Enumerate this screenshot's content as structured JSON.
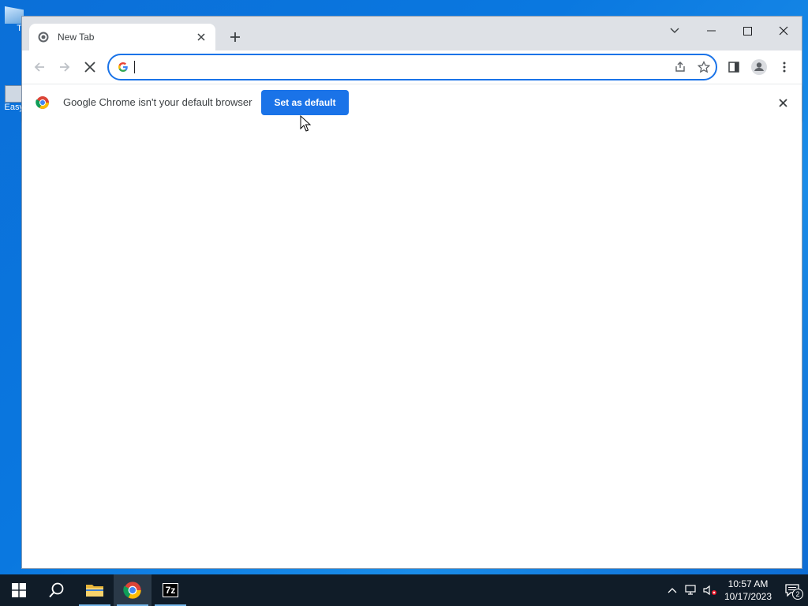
{
  "browser": {
    "tab": {
      "title": "New Tab"
    },
    "omnibox": {
      "value": "",
      "placeholder": ""
    },
    "infobar": {
      "message": "Google Chrome isn't your default browser",
      "button_label": "Set as default"
    }
  },
  "taskbar": {
    "items": [
      "start-icon",
      "search-icon",
      "file-explorer-icon",
      "chrome-icon",
      "7zip-icon"
    ],
    "sevenzip_label": "7z",
    "clock": {
      "time": "10:57 AM",
      "date": "10/17/2023"
    },
    "notification_count": "2"
  },
  "desktop": {
    "icon1_label": "Ti",
    "icon2_label": "Easy"
  },
  "colors": {
    "accent": "#1a73e8",
    "taskbar": "#101c28",
    "desktop": "#0a78e0"
  }
}
